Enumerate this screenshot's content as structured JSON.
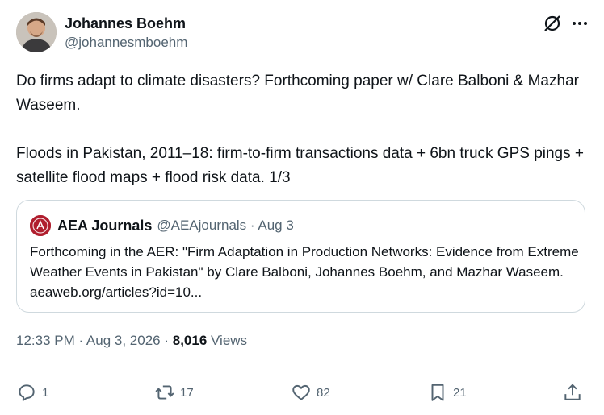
{
  "author": {
    "name": "Johannes Boehm",
    "handle": "@johannesmboehm",
    "avatar_icon": "avatar-icon"
  },
  "header_icons": [
    "grok-icon",
    "more-icon"
  ],
  "tweet": {
    "paragraph1": "Do firms adapt to climate disasters? Forthcoming paper w/ Clare Balboni & Mazhar Waseem.",
    "paragraph2": "Floods in Pakistan, 2011–18: firm-to-firm transactions data + 6bn truck GPS pings + satellite flood maps + flood risk data. 1/3"
  },
  "quote": {
    "name": "AEA Journals",
    "meta": "@AEAjournals · Aug 3",
    "text": "Forthcoming in the AER: \"Firm Adaptation in Production Networks: Evidence from Extreme Weather Events in Pakistan\" by Clare Balboni, Johannes Boehm, and Mazhar Waseem. aeaweb.org/articles?id=10..."
  },
  "meta": {
    "datetime": "12:33 PM · Aug 3, 2026 · ",
    "views_count": "8,016",
    "views_label": " Views"
  },
  "actions": {
    "replies": "1",
    "reposts": "17",
    "likes": "82",
    "bookmarks": "21"
  },
  "colors": {
    "text_primary": "#0f1419",
    "text_secondary": "#536471",
    "border": "#cfd9de",
    "aea_logo": "#b01e2e"
  }
}
